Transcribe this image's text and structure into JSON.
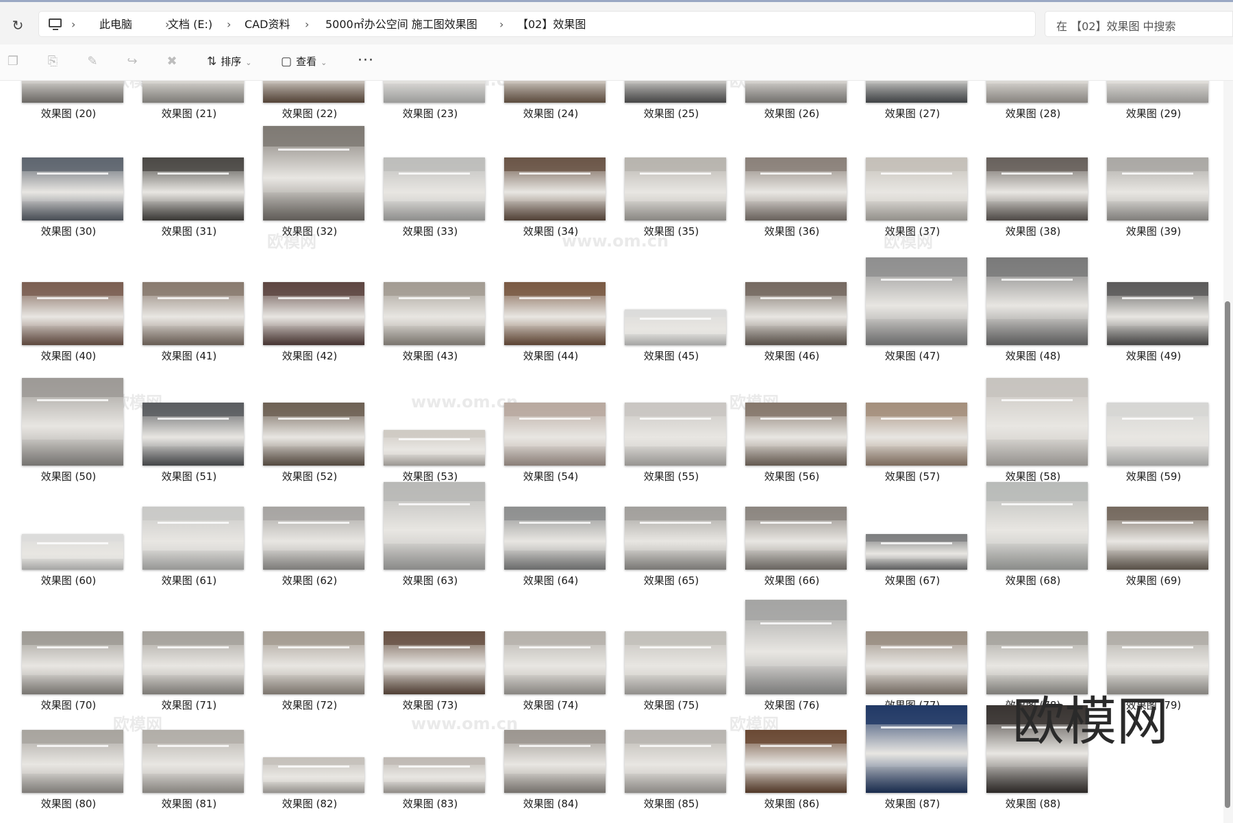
{
  "breadcrumb": {
    "items": [
      "此电脑",
      "文档 (E:)",
      "CAD资料",
      "5000㎡办公空间 施工图效果图",
      "【02】效果图"
    ]
  },
  "search": {
    "placeholder": "在 【02】效果图 中搜索"
  },
  "toolbar": {
    "icons": [
      "copy-icon",
      "paste-icon",
      "rename-icon",
      "share-icon",
      "delete-icon"
    ],
    "sort_label": "排序",
    "view_label": "查看",
    "more_label": "···"
  },
  "watermark": {
    "big_text": "欧模网",
    "small_texts": [
      "欧模网",
      "www.om.cn"
    ]
  },
  "files": [
    {
      "name": "效果图 (20)",
      "row": 0,
      "col": 0,
      "shape": "wide",
      "tone": "#8f8b86"
    },
    {
      "name": "效果图 (21)",
      "row": 0,
      "col": 1,
      "shape": "wide",
      "tone": "#a9a6a0"
    },
    {
      "name": "效果图 (22)",
      "row": 0,
      "col": 2,
      "shape": "wide",
      "tone": "#6f5a4a"
    },
    {
      "name": "效果图 (23)",
      "row": 0,
      "col": 3,
      "shape": "wide",
      "tone": "#cfcfcd"
    },
    {
      "name": "效果图 (24)",
      "row": 0,
      "col": 4,
      "shape": "wide",
      "tone": "#7a6553"
    },
    {
      "name": "效果图 (25)",
      "row": 0,
      "col": 5,
      "shape": "wide",
      "tone": "#5e5e5e"
    },
    {
      "name": "效果图 (26)",
      "row": 0,
      "col": 6,
      "shape": "wide",
      "tone": "#9a9793"
    },
    {
      "name": "效果图 (27)",
      "row": 0,
      "col": 7,
      "shape": "wide",
      "tone": "#55595c"
    },
    {
      "name": "效果图 (28)",
      "row": 0,
      "col": 8,
      "shape": "wide",
      "tone": "#b5b0aa"
    },
    {
      "name": "效果图 (29)",
      "row": 0,
      "col": 9,
      "shape": "wide",
      "tone": "#c9c7c3"
    },
    {
      "name": "效果图 (30)",
      "row": 1,
      "col": 0,
      "shape": "wide",
      "tone": "#5f6670"
    },
    {
      "name": "效果图 (31)",
      "row": 1,
      "col": 1,
      "shape": "wide",
      "tone": "#4c4a46"
    },
    {
      "name": "效果图 (32)",
      "row": 1,
      "col": 2,
      "shape": "tall",
      "tone": "#7f7a74"
    },
    {
      "name": "效果图 (33)",
      "row": 1,
      "col": 3,
      "shape": "wide",
      "tone": "#bdbdbb"
    },
    {
      "name": "效果图 (34)",
      "row": 1,
      "col": 4,
      "shape": "wide",
      "tone": "#6b5648"
    },
    {
      "name": "效果图 (35)",
      "row": 1,
      "col": 5,
      "shape": "wide",
      "tone": "#b7b4ae"
    },
    {
      "name": "效果图 (36)",
      "row": 1,
      "col": 6,
      "shape": "wide",
      "tone": "#8b817a"
    },
    {
      "name": "效果图 (37)",
      "row": 1,
      "col": 7,
      "shape": "wide",
      "tone": "#c4c0b9"
    },
    {
      "name": "效果图 (38)",
      "row": 1,
      "col": 8,
      "shape": "wide",
      "tone": "#68625d"
    },
    {
      "name": "效果图 (39)",
      "row": 1,
      "col": 9,
      "shape": "wide",
      "tone": "#aaa8a4"
    },
    {
      "name": "效果图 (40)",
      "row": 2,
      "col": 0,
      "shape": "wide",
      "tone": "#7b5f52"
    },
    {
      "name": "效果图 (41)",
      "row": 2,
      "col": 1,
      "shape": "wide",
      "tone": "#8a7b70"
    },
    {
      "name": "效果图 (42)",
      "row": 2,
      "col": 2,
      "shape": "wide",
      "tone": "#5e4642"
    },
    {
      "name": "效果图 (43)",
      "row": 2,
      "col": 3,
      "shape": "wide",
      "tone": "#a39c93"
    },
    {
      "name": "效果图 (44)",
      "row": 2,
      "col": 4,
      "shape": "wide",
      "tone": "#7a5a44"
    },
    {
      "name": "效果图 (45)",
      "row": 2,
      "col": 5,
      "shape": "short",
      "tone": "#dcdcda"
    },
    {
      "name": "效果图 (46)",
      "row": 2,
      "col": 6,
      "shape": "wide",
      "tone": "#756a61"
    },
    {
      "name": "效果图 (47)",
      "row": 2,
      "col": 7,
      "shape": "tall2",
      "tone": "#8f8f8f"
    },
    {
      "name": "效果图 (48)",
      "row": 2,
      "col": 8,
      "shape": "tall2",
      "tone": "#7a7a7a"
    },
    {
      "name": "效果图 (49)",
      "row": 2,
      "col": 9,
      "shape": "wide",
      "tone": "#5c5b5a"
    },
    {
      "name": "效果图 (50)",
      "row": 3,
      "col": 0,
      "shape": "tall2",
      "tone": "#9d9a96"
    },
    {
      "name": "效果图 (51)",
      "row": 3,
      "col": 1,
      "shape": "wide",
      "tone": "#5b5d60"
    },
    {
      "name": "效果图 (52)",
      "row": 3,
      "col": 2,
      "shape": "wide",
      "tone": "#6f6155"
    },
    {
      "name": "效果图 (53)",
      "row": 3,
      "col": 3,
      "shape": "short",
      "tone": "#cfcac3"
    },
    {
      "name": "效果图 (54)",
      "row": 3,
      "col": 4,
      "shape": "wide",
      "tone": "#b8a9a0"
    },
    {
      "name": "效果图 (55)",
      "row": 3,
      "col": 5,
      "shape": "wide",
      "tone": "#c9c6c2"
    },
    {
      "name": "效果图 (56)",
      "row": 3,
      "col": 6,
      "shape": "wide",
      "tone": "#86786c"
    },
    {
      "name": "效果图 (57)",
      "row": 3,
      "col": 7,
      "shape": "wide",
      "tone": "#a58f7c"
    },
    {
      "name": "效果图 (58)",
      "row": 3,
      "col": 8,
      "shape": "tall2",
      "tone": "#c7c3be"
    },
    {
      "name": "效果图 (59)",
      "row": 3,
      "col": 9,
      "shape": "wide",
      "tone": "#d6d6d4"
    },
    {
      "name": "效果图 (60)",
      "row": 4,
      "col": 0,
      "shape": "short",
      "tone": "#dcdcda"
    },
    {
      "name": "效果图 (61)",
      "row": 4,
      "col": 1,
      "shape": "wide",
      "tone": "#c9c9c7"
    },
    {
      "name": "效果图 (62)",
      "row": 4,
      "col": 2,
      "shape": "wide",
      "tone": "#a7a5a2"
    },
    {
      "name": "效果图 (63)",
      "row": 4,
      "col": 3,
      "shape": "tall2",
      "tone": "#b8b8b6"
    },
    {
      "name": "效果图 (64)",
      "row": 4,
      "col": 4,
      "shape": "wide",
      "tone": "#8e8f8f"
    },
    {
      "name": "效果图 (65)",
      "row": 4,
      "col": 5,
      "shape": "wide",
      "tone": "#a2a09c"
    },
    {
      "name": "效果图 (66)",
      "row": 4,
      "col": 6,
      "shape": "wide",
      "tone": "#8c8680"
    },
    {
      "name": "效果图 (67)",
      "row": 4,
      "col": 7,
      "shape": "short",
      "tone": "#7e7f80"
    },
    {
      "name": "效果图 (68)",
      "row": 4,
      "col": 8,
      "shape": "tall2",
      "tone": "#b9bbb8"
    },
    {
      "name": "效果图 (69)",
      "row": 4,
      "col": 9,
      "shape": "wide",
      "tone": "#756a5f"
    },
    {
      "name": "效果图 (70)",
      "row": 5,
      "col": 0,
      "shape": "wide",
      "tone": "#9f9b95"
    },
    {
      "name": "效果图 (71)",
      "row": 5,
      "col": 1,
      "shape": "wide",
      "tone": "#a6a29c"
    },
    {
      "name": "效果图 (72)",
      "row": 5,
      "col": 2,
      "shape": "wide",
      "tone": "#a59c92"
    },
    {
      "name": "效果图 (73)",
      "row": 5,
      "col": 3,
      "shape": "wide",
      "tone": "#6a5446"
    },
    {
      "name": "效果图 (74)",
      "row": 5,
      "col": 4,
      "shape": "wide",
      "tone": "#b6b2ac"
    },
    {
      "name": "效果图 (75)",
      "row": 5,
      "col": 5,
      "shape": "wide",
      "tone": "#c2bfba"
    },
    {
      "name": "效果图 (76)",
      "row": 5,
      "col": 6,
      "shape": "tall",
      "tone": "#a4a4a3"
    },
    {
      "name": "效果图 (77)",
      "row": 5,
      "col": 7,
      "shape": "wide",
      "tone": "#9a8e83"
    },
    {
      "name": "效果图 (78)",
      "row": 5,
      "col": 8,
      "shape": "wide",
      "tone": "#a7a59f"
    },
    {
      "name": "效果图 (79)",
      "row": 5,
      "col": 9,
      "shape": "wide",
      "tone": "#b0ada7"
    },
    {
      "name": "效果图 (80)",
      "row": 6,
      "col": 0,
      "shape": "wide",
      "tone": "#a8a49f"
    },
    {
      "name": "效果图 (81)",
      "row": 6,
      "col": 1,
      "shape": "wide",
      "tone": "#b2aea8"
    },
    {
      "name": "效果图 (82)",
      "row": 6,
      "col": 2,
      "shape": "short",
      "tone": "#c5c1bb"
    },
    {
      "name": "效果图 (83)",
      "row": 6,
      "col": 3,
      "shape": "short",
      "tone": "#bfbab4"
    },
    {
      "name": "效果图 (84)",
      "row": 6,
      "col": 4,
      "shape": "wide",
      "tone": "#9c9690"
    },
    {
      "name": "效果图 (85)",
      "row": 6,
      "col": 5,
      "shape": "wide",
      "tone": "#b9b5b0"
    },
    {
      "name": "效果图 (86)",
      "row": 6,
      "col": 6,
      "shape": "wide",
      "tone": "#6b4a35"
    },
    {
      "name": "效果图 (87)",
      "row": 6,
      "col": 7,
      "shape": "tall2",
      "tone": "#223a66"
    },
    {
      "name": "效果图 (88)",
      "row": 6,
      "col": 8,
      "shape": "tall2",
      "tone": "#3a3532"
    }
  ]
}
